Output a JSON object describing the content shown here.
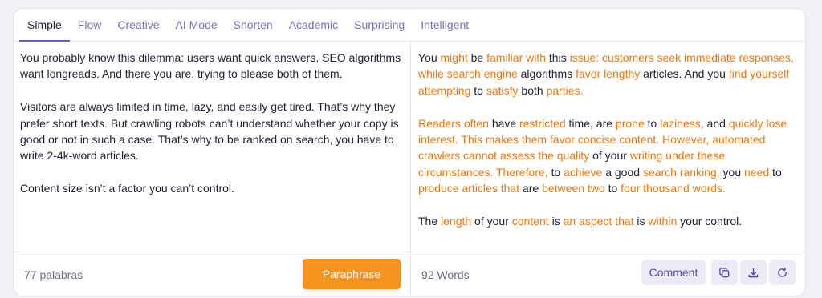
{
  "tabs": [
    {
      "label": "Simple"
    },
    {
      "label": "Flow"
    },
    {
      "label": "Creative"
    },
    {
      "label": "AI Mode"
    },
    {
      "label": "Shorten"
    },
    {
      "label": "Academic"
    },
    {
      "label": "Surprising"
    },
    {
      "label": "Intelligent"
    }
  ],
  "active_tab": "Simple",
  "input": {
    "paragraphs": [
      "You probably know this dilemma: users want quick answers, SEO algorithms want longreads. And there you are, trying to please both of them.",
      "Visitors are always limited in time, lazy, and easily get tired. That’s why they prefer short texts. But crawling robots can’t understand whether your copy is good or not in such a case. That’s why to be ranked on search, you have to write 2-4k-word articles.",
      "Content size isn’t a factor you can’t control."
    ],
    "word_count": "77 palabras"
  },
  "output": {
    "paragraphs": [
      {
        "segments": [
          {
            "text": "You ",
            "changed": false
          },
          {
            "text": "might",
            "changed": true
          },
          {
            "text": " be ",
            "changed": false
          },
          {
            "text": "familiar with",
            "changed": true
          },
          {
            "text": " this ",
            "changed": false
          },
          {
            "text": "issue: customers seek immediate responses, while search engine",
            "changed": true
          },
          {
            "text": " algorithms ",
            "changed": false
          },
          {
            "text": "favor lengthy",
            "changed": true
          },
          {
            "text": " articles. And you ",
            "changed": false
          },
          {
            "text": "find yourself attempting",
            "changed": true
          },
          {
            "text": " to ",
            "changed": false
          },
          {
            "text": "satisfy",
            "changed": true
          },
          {
            "text": " both ",
            "changed": false
          },
          {
            "text": "parties.",
            "changed": true
          }
        ]
      },
      {
        "segments": [
          {
            "text": "Readers",
            "changed": true
          },
          {
            "text": " ",
            "changed": false
          },
          {
            "text": "often",
            "changed": true
          },
          {
            "text": " have ",
            "changed": false
          },
          {
            "text": "restricted",
            "changed": true
          },
          {
            "text": " time, are ",
            "changed": false
          },
          {
            "text": "prone",
            "changed": true
          },
          {
            "text": " to ",
            "changed": false
          },
          {
            "text": "laziness,",
            "changed": true
          },
          {
            "text": " and ",
            "changed": false
          },
          {
            "text": "quickly lose interest. This makes them favor concise content. However, automated crawlers cannot assess the quality",
            "changed": true
          },
          {
            "text": " of your ",
            "changed": false
          },
          {
            "text": "writing under these circumstances. Therefore,",
            "changed": true
          },
          {
            "text": " to ",
            "changed": false
          },
          {
            "text": "achieve",
            "changed": true
          },
          {
            "text": " a good ",
            "changed": false
          },
          {
            "text": "search ranking,",
            "changed": true
          },
          {
            "text": " you ",
            "changed": false
          },
          {
            "text": "need",
            "changed": true
          },
          {
            "text": " to ",
            "changed": false
          },
          {
            "text": "produce articles that",
            "changed": true
          },
          {
            "text": " are ",
            "changed": false
          },
          {
            "text": "between two",
            "changed": true
          },
          {
            "text": " to ",
            "changed": false
          },
          {
            "text": "four thousand words.",
            "changed": true
          }
        ]
      },
      {
        "segments": [
          {
            "text": "The ",
            "changed": false
          },
          {
            "text": "length",
            "changed": true
          },
          {
            "text": " of your ",
            "changed": false
          },
          {
            "text": "content",
            "changed": true
          },
          {
            "text": " is ",
            "changed": false
          },
          {
            "text": "an aspect that",
            "changed": true
          },
          {
            "text": " is ",
            "changed": false
          },
          {
            "text": "within",
            "changed": true
          },
          {
            "text": " your control.",
            "changed": false
          }
        ]
      }
    ],
    "word_count": "92 Words"
  },
  "buttons": {
    "paraphrase": "Paraphrase",
    "comment": "Comment"
  },
  "icons": {
    "copy": "copy-icon",
    "download": "download-icon",
    "refresh": "refresh-icon"
  },
  "colors": {
    "accent": "#f7941d",
    "changed_text": "#f2760f",
    "tab_text": "#7e6cbe",
    "active_underline": "#6a5ad3"
  }
}
